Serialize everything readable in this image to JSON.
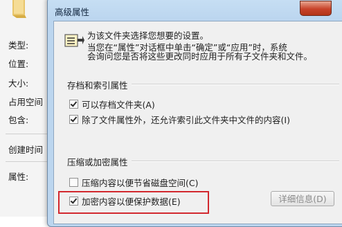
{
  "background_window": {
    "labels": [
      "类型:",
      "位置:",
      "大小:",
      "占用空间",
      "包含:",
      "创建时间",
      "属性:"
    ]
  },
  "dialog": {
    "title": "高级属性",
    "description_line1": "为该文件夹选择您想要的设置。",
    "description_line2": "当您在“属性”对话框中单击“确定”或“应用”时，系统",
    "description_line3": "会询问您是否将这些更改同时应用于所有子文件夹和文件。",
    "archive_group": {
      "title": "存档和索引属性",
      "options": [
        {
          "label": "可以存档文件夹(A)",
          "checked": true
        },
        {
          "label": "除了文件属性外，还允许索引此文件夹中文件的内容(I)",
          "checked": true
        }
      ]
    },
    "compress_group": {
      "title": "压缩或加密属性",
      "options": [
        {
          "label": "压缩内容以便节省磁盘空间(C)",
          "checked": false
        },
        {
          "label": "加密内容以便保护数据(E)",
          "checked": true
        }
      ],
      "details_button": "详细信息(D)"
    }
  },
  "colors": {
    "highlight": "#d2282e",
    "title_bar": "#bcd6ef",
    "close_button": "#c7432a"
  }
}
